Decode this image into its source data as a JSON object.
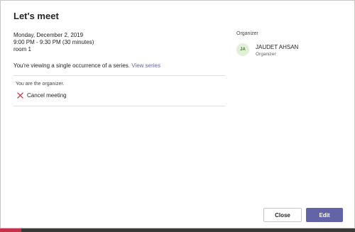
{
  "dialog": {
    "title": "Let's meet",
    "date": "Monday, December 2, 2019",
    "time": "9:00 PM - 9:30 PM (30 minutes)",
    "location": "room 1",
    "series_text": "You're viewing a single occurrence of a series.",
    "series_link": "View series",
    "organizer_note": "You are the organizer.",
    "cancel_label": "Cancel meeting",
    "organizer_header": "Organizer",
    "organizer": {
      "initials": "JA",
      "name": "JAUDET AHSAN",
      "role": "Organizer"
    },
    "buttons": {
      "close": "Close",
      "edit": "Edit"
    }
  },
  "colors": {
    "accent": "#6264a7",
    "cancel_icon": "#c4314b",
    "avatar_bg": "#e2efd9"
  },
  "icons": {
    "cancel": "close-x-icon"
  }
}
